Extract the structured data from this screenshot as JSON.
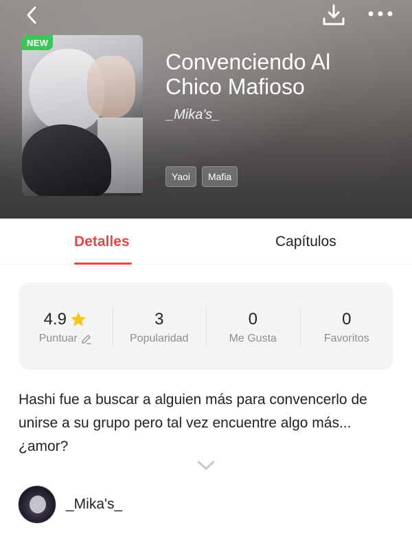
{
  "header": {
    "back_icon": "back-arrow-icon",
    "download_icon": "download-icon",
    "more_icon": "more-dots-icon"
  },
  "book": {
    "badge": "NEW",
    "title": "Convenciendo Al Chico Mafioso",
    "author": "_Mika's_",
    "tags": [
      "Yaoi",
      "Mafia"
    ]
  },
  "tabs": [
    {
      "label": "Detalles",
      "active": true
    },
    {
      "label": "Capítulos",
      "active": false
    }
  ],
  "stats": [
    {
      "value": "4.9",
      "label": "Puntuar"
    },
    {
      "value": "3",
      "label": "Popularidad"
    },
    {
      "value": "0",
      "label": "Me Gusta"
    },
    {
      "value": "0",
      "label": "Favoritos"
    }
  ],
  "synopsis": "Hashi  fue a buscar a alguien más para convencerlo de unirse a su grupo pero tal vez encuentre algo más...¿amor?",
  "author_profile": {
    "name": "_Mika's_"
  },
  "colors": {
    "accent": "#ea4446",
    "new_badge": "#3cc35a",
    "star": "#f5c518"
  }
}
